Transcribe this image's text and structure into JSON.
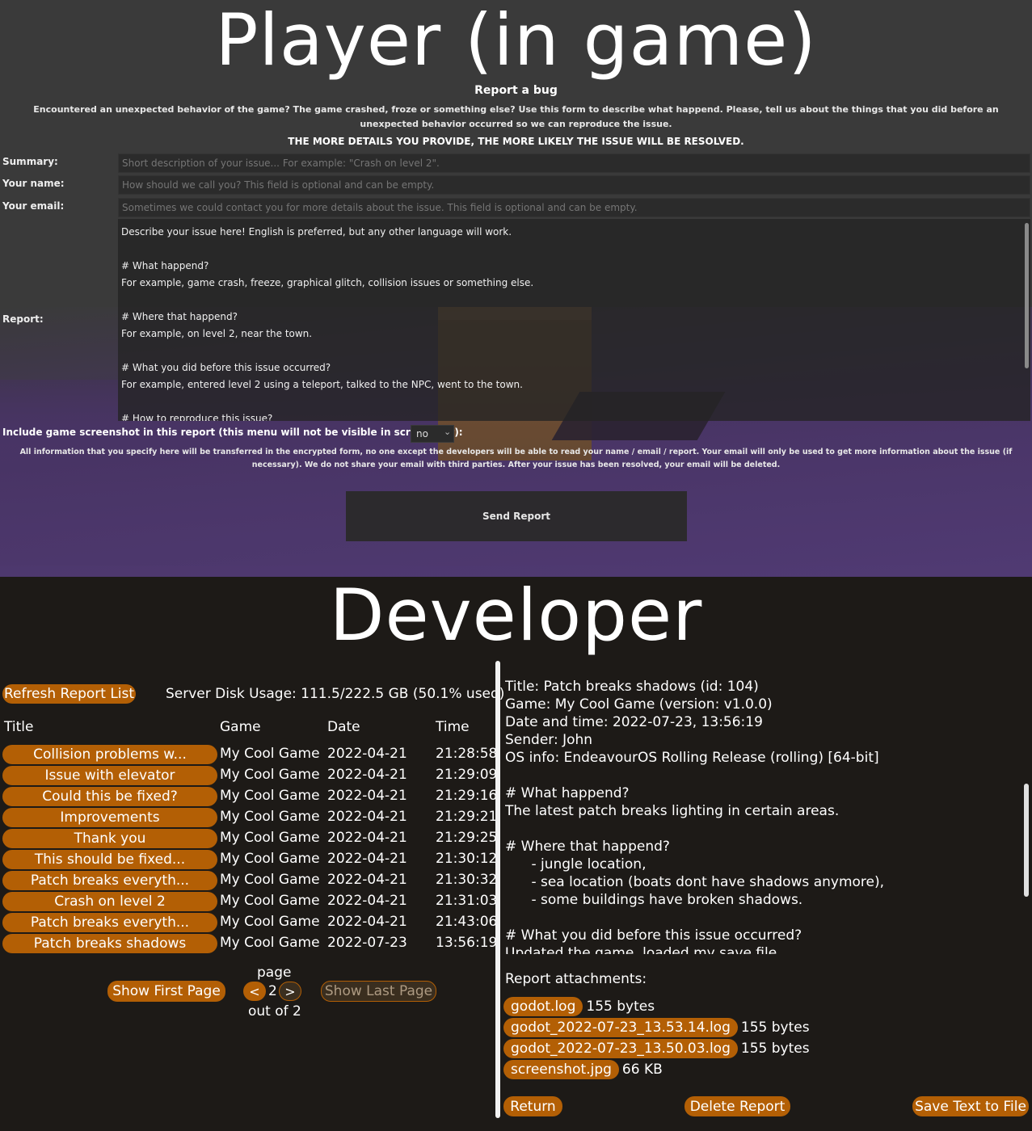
{
  "player": {
    "heading": "Player (in game)",
    "title": "Report a bug",
    "description": "Encountered an unexpected behavior of the game? The game crashed, froze or something else? Use this form to describe what happend. Please, tell us about the things that you did before an unexpected behavior occurred so we can reproduce the issue.",
    "emphasis": "THE MORE DETAILS YOU PROVIDE, THE MORE LIKELY THE ISSUE WILL BE RESOLVED.",
    "summary_label": "Summary:",
    "summary_placeholder": "Short description of your issue... For example: \"Crash on level 2\".",
    "name_label": "Your name:",
    "name_placeholder": "How should we call you? This field is optional and can be empty.",
    "email_label": "Your email:",
    "email_placeholder": "Sometimes we could contact you for more details about the issue. This field is optional and can be empty.",
    "report_label": "Report:",
    "report_text": "Describe your issue here! English is preferred, but any other language will work.\n\n# What happend?\nFor example, game crash, freeze, graphical glitch, collision issues or something else.\n\n# Where that happend?\nFor example, on level 2, near the town.\n\n# What you did before this issue occurred?\nFor example, entered level 2 using a teleport, talked to the NPC, went to the town.\n\n# How to reproduce this issue?",
    "screenshot_label": "Include game screenshot in this report (this menu will not be visible in screenshot):",
    "screenshot_value": "no",
    "privacy_note": "All information that you specify here will be transferred in the encrypted form, no one except the developers will be able to read your name / email / report. Your email will only be used to get more information about the issue (if necessary). We do not share your email with third parties. After your issue has been resolved, your email will be deleted.",
    "send_label": "Send Report"
  },
  "developer": {
    "heading": "Developer",
    "refresh_label": "Refresh Report List",
    "disk_usage": "Server Disk Usage: 111.5/222.5 GB (50.1% used)",
    "columns": {
      "title": "Title",
      "game": "Game",
      "date": "Date",
      "time": "Time"
    },
    "rows": [
      {
        "title": "Collision problems w...",
        "game": "My Cool Game",
        "date": "2022-04-21",
        "time": "21:28:58"
      },
      {
        "title": "Issue with elevator",
        "game": "My Cool Game",
        "date": "2022-04-21",
        "time": "21:29:09"
      },
      {
        "title": "Could this be fixed?",
        "game": "My Cool Game",
        "date": "2022-04-21",
        "time": "21:29:16"
      },
      {
        "title": "Improvements",
        "game": "My Cool Game",
        "date": "2022-04-21",
        "time": "21:29:21"
      },
      {
        "title": "Thank you",
        "game": "My Cool Game",
        "date": "2022-04-21",
        "time": "21:29:25"
      },
      {
        "title": "This should be fixed...",
        "game": "My Cool Game",
        "date": "2022-04-21",
        "time": "21:30:12"
      },
      {
        "title": "Patch breaks everyth...",
        "game": "My Cool Game",
        "date": "2022-04-21",
        "time": "21:30:32"
      },
      {
        "title": "Crash on level 2",
        "game": "My Cool Game",
        "date": "2022-04-21",
        "time": "21:31:03"
      },
      {
        "title": "Patch breaks everyth...",
        "game": "My Cool Game",
        "date": "2022-04-21",
        "time": "21:43:06"
      },
      {
        "title": "Patch breaks shadows",
        "game": "My Cool Game",
        "date": "2022-07-23",
        "time": "13:56:19"
      }
    ],
    "pagination": {
      "first_label": "Show First Page",
      "page_label": "page",
      "prev_label": "<",
      "current": "2",
      "next_label": ">",
      "out_of": "out of 2",
      "last_label": "Show Last Page"
    },
    "details": "Title: Patch breaks shadows (id: 104)\nGame: My Cool Game (version: v1.0.0)\nDate and time: 2022-07-23, 13:56:19\nSender: John\nOS info: EndeavourOS Rolling Release (rolling) [64-bit]\n\n# What happend?\nThe latest patch breaks lighting in certain areas.\n\n# Where that happend?\n      - jungle location,\n      - sea location (boats dont have shadows anymore),\n      - some buildings have broken shadows.\n\n# What you did before this issue occurred?\nUpdated the game, loaded my save file.",
    "attachments_label": "Report attachments:",
    "attachments": [
      {
        "name": "godot.log",
        "size": "155 bytes"
      },
      {
        "name": "godot_2022-07-23_13.53.14.log",
        "size": "155 bytes"
      },
      {
        "name": "godot_2022-07-23_13.50.03.log",
        "size": "155 bytes"
      },
      {
        "name": "screenshot.jpg",
        "size": "66 KB"
      }
    ],
    "return_label": "Return",
    "delete_label": "Delete Report",
    "save_label": "Save Text to File"
  },
  "colors": {
    "accent": "#b35f05",
    "background": "#1d1a17",
    "player_bg": "#3a3a3a",
    "purple_floor": "#513a74"
  },
  "icons": [
    "chevron-down-icon"
  ]
}
